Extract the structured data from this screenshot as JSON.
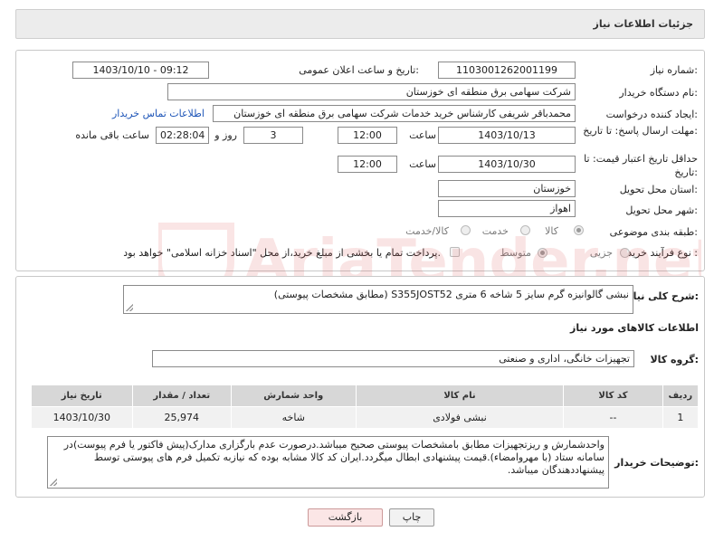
{
  "header": {
    "title": "جزئیات اطلاعات نیاز"
  },
  "labels": {
    "need_number": "شماره نیاز:",
    "announce_datetime": "تاریخ و ساعت اعلان عمومی:",
    "buyer_org": "نام دستگاه خریدار:",
    "requester": "ایجاد کننده درخواست:",
    "reply_deadline": "مهلت ارسال پاسخ: تا تاریخ:",
    "price_validity": "حداقل تاریخ اعتبار قیمت: تا تاریخ:",
    "time": "ساعت",
    "day_and": "روز و",
    "remaining": "ساعت باقی مانده",
    "province": "استان محل تحویل:",
    "city": "شهر محل تحویل:",
    "category": "طبقه بندی موضوعی:",
    "process_type": "نوع فرآیند خرید :",
    "general_desc": "شرح کلی نیاز:",
    "items_info": "اطلاعات کالاهای مورد نیاز",
    "goods_group": "گروه کالا:",
    "buyer_notes": "توضیحات خریدار:"
  },
  "fields": {
    "need_number": "1103001262001199",
    "announce_datetime": "1403/10/10 - 09:12",
    "buyer_org": "شرکت سهامی برق منطقه ای خوزستان",
    "requester": "محمدباقر شریفی کارشناس خرید خدمات شرکت سهامی برق منطقه ای خوزستان",
    "contact_link": "اطلاعات تماس خریدار",
    "reply_date": "1403/10/13",
    "reply_time": "12:00",
    "reply_days": "3",
    "reply_remaining": "02:28:04",
    "validity_date": "1403/10/30",
    "validity_time": "12:00",
    "province": "خوزستان",
    "city": "اهواز",
    "general_desc": "نبشی گالوانیزه گرم سایز 5 شاخه 6 متری S355JOST52 (مطابق مشخصات پیوستی)",
    "goods_group": "تجهیزات خانگی، اداری و صنعتی",
    "buyer_notes": "واحدشمارش و ریزتجهیزات مطابق بامشخصات پیوستی صحیح میباشد.درصورت عدم بارگزاری مدارک(پیش فاکتور یا فرم پیوست)در سامانه ستاد (با مهروامضاء).قیمت پیشنهادی ابطال میگردد.ایران کد کالا مشابه بوده که نیازبه تکمیل فرم های پیوستی توسط پیشنهاددهندگان میباشد."
  },
  "category_options": [
    {
      "label": "کالا",
      "selected": true
    },
    {
      "label": "خدمت",
      "selected": false
    },
    {
      "label": "کالا/خدمت",
      "selected": false
    }
  ],
  "process_options": [
    {
      "label": "جزیی",
      "selected": false
    },
    {
      "label": "متوسط",
      "selected": true
    }
  ],
  "process_note": "پرداخت تمام یا بخشی از مبلغ خرید،از محل \"اسناد خزانه اسلامی\" خواهد بود.",
  "table": {
    "headers": [
      "ردیف",
      "کد کالا",
      "نام کالا",
      "واحد شمارش",
      "تعداد / مقدار",
      "تاریخ نیاز"
    ],
    "rows": [
      [
        "1",
        "--",
        "نبشی فولادی",
        "شاخه",
        "25,974",
        "1403/10/30"
      ]
    ]
  },
  "buttons": {
    "print": "چاپ",
    "back": "بازگشت"
  },
  "watermark": {
    "text": "AriaTender.net",
    "color": "#e06060"
  }
}
